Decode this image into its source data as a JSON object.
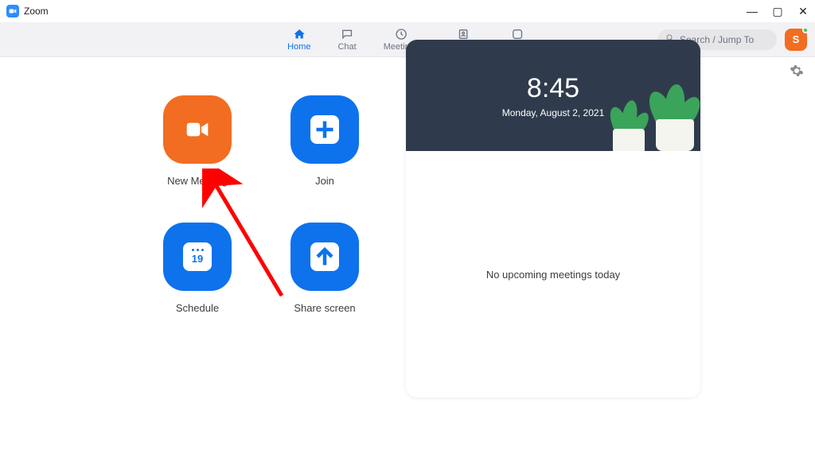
{
  "window": {
    "title": "Zoom"
  },
  "nav": {
    "items": [
      {
        "label": "Home",
        "active": true
      },
      {
        "label": "Chat"
      },
      {
        "label": "Meetings"
      },
      {
        "label": "Contacts"
      },
      {
        "label": "Apps"
      }
    ]
  },
  "search": {
    "placeholder": "Search / Jump To"
  },
  "avatar": {
    "initial": "S"
  },
  "actions": {
    "new_meeting": "New Meeting",
    "join": "Join",
    "schedule": "Schedule",
    "schedule_day": "19",
    "share_screen": "Share screen"
  },
  "calendar": {
    "time": "8:45",
    "date": "Monday, August 2, 2021",
    "empty_message": "No upcoming meetings today"
  }
}
